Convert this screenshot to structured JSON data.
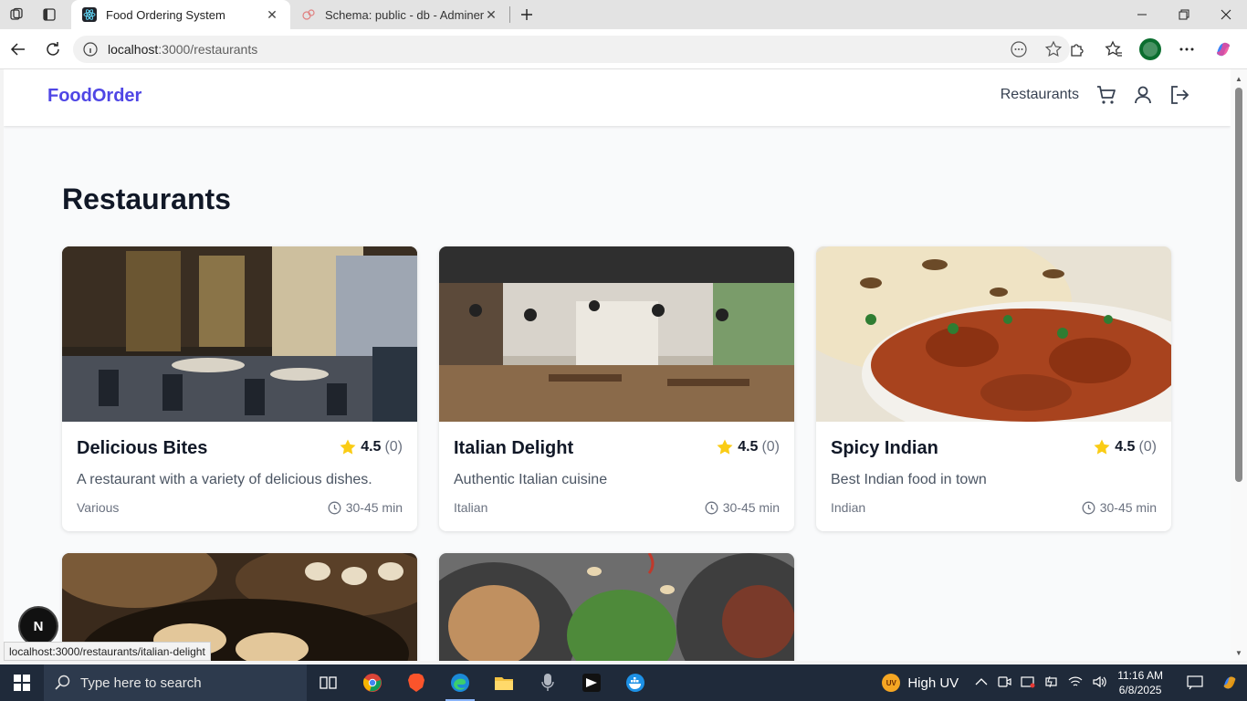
{
  "browser": {
    "tabs": [
      {
        "title": "Food Ordering System",
        "active": true
      },
      {
        "title": "Schema: public - db - Adminer",
        "active": false
      }
    ],
    "url_host": "localhost",
    "url_path": ":3000/restaurants",
    "status_url": "localhost:3000/restaurants/italian-delight"
  },
  "app": {
    "brand": "FoodOrder",
    "nav_link": "Restaurants",
    "brand_color": "#4f46e5"
  },
  "page": {
    "title": "Restaurants"
  },
  "restaurants": [
    {
      "name": "Delicious Bites",
      "rating": "4.5",
      "count": "(0)",
      "description": "A restaurant with a variety of delicious dishes.",
      "cuisine": "Various",
      "time": "30-45 min"
    },
    {
      "name": "Italian Delight",
      "rating": "4.5",
      "count": "(0)",
      "description": "Authentic Italian cuisine",
      "cuisine": "Italian",
      "time": "30-45 min"
    },
    {
      "name": "Spicy Indian",
      "rating": "4.5",
      "count": "(0)",
      "description": "Best Indian food in town",
      "cuisine": "Indian",
      "time": "30-45 min"
    }
  ],
  "next_badge": "N",
  "taskbar": {
    "search_placeholder": "Type here to search",
    "weather": "High UV",
    "uv_badge": "UV",
    "time": "11:16 AM",
    "date": "6/8/2025"
  }
}
